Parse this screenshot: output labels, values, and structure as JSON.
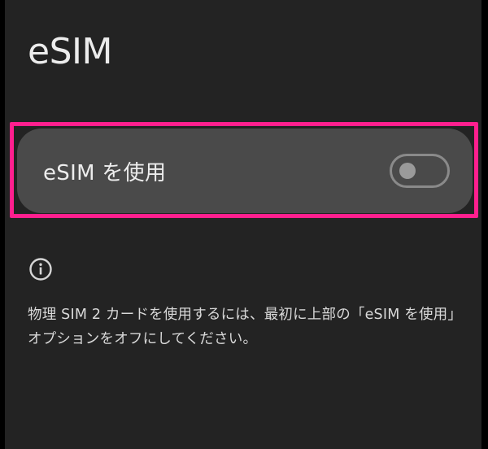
{
  "page": {
    "title": "eSIM"
  },
  "esim_toggle": {
    "label": "eSIM を使用",
    "state": "off"
  },
  "info": {
    "icon": "info-icon",
    "text": "物理 SIM 2 カードを使用するには、最初に上部の「eSIM を使用」オプションをオフにしてください。"
  },
  "colors": {
    "background": "#232323",
    "card": "#4a4a4a",
    "highlight": "#ff1f8e"
  }
}
